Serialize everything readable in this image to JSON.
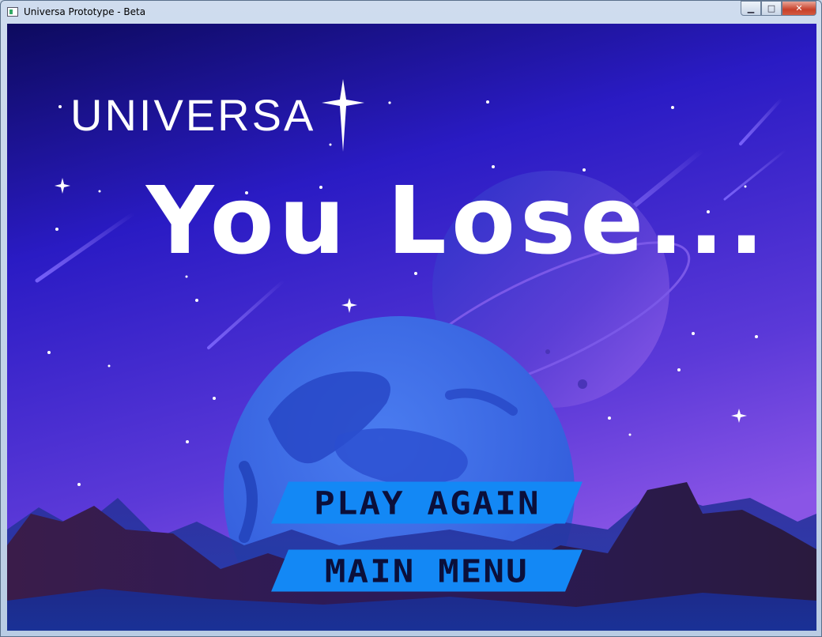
{
  "window": {
    "title": "Universa Prototype - Beta",
    "controls": {
      "minimize": "▁",
      "maximize": "□",
      "close": "✕"
    }
  },
  "game": {
    "brand": "UNIVERSA",
    "headline": "You Lose...",
    "buttons": {
      "play_again": "PLAY AGAIN",
      "main_menu": "MAIN MENU"
    }
  },
  "colors": {
    "sky_top": "#0b0a6e",
    "sky_bottom": "#7a4fe0",
    "button_fill": "#1388f5",
    "button_text": "#0b0f3a"
  }
}
